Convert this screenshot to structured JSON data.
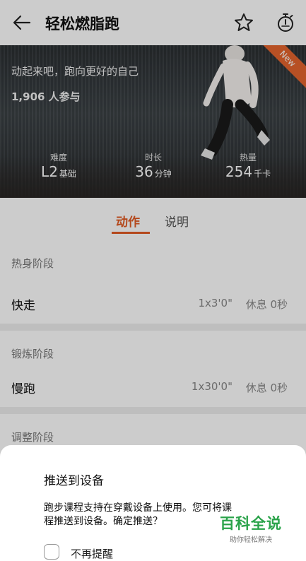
{
  "header": {
    "title": "轻松燃脂跑",
    "back_icon": "arrow-left-icon",
    "favorite_icon": "star-icon",
    "timer_icon": "stopwatch-icon"
  },
  "hero": {
    "tagline": "动起来吧，跑向更好的自己",
    "participants": "1,906 人参与",
    "badge": "New",
    "stats": [
      {
        "label": "难度",
        "value": "L2",
        "unit": "基础"
      },
      {
        "label": "时长",
        "value": "36",
        "unit": "分钟"
      },
      {
        "label": "热量",
        "value": "254",
        "unit": "千卡"
      }
    ]
  },
  "tabs": [
    {
      "label": "动作",
      "active": true
    },
    {
      "label": "说明",
      "active": false
    }
  ],
  "sections": [
    {
      "header": "热身阶段",
      "item": {
        "name": "快走",
        "reps": "1x3'0\"",
        "rest": "休息 0秒"
      }
    },
    {
      "header": "锻炼阶段",
      "item": {
        "name": "慢跑",
        "reps": "1x30'0\"",
        "rest": "休息 0秒"
      }
    },
    {
      "header": "调整阶段"
    }
  ],
  "dialog": {
    "title": "推送到设备",
    "message_line1": "跑步课程支持在穿戴设备上使用。您可将课",
    "message_line2": "程推送到设备。确定推送？",
    "checkbox_label": "不再提醒",
    "checked": false
  },
  "watermark": {
    "main": "百科全说",
    "sub": "助你轻松解决"
  },
  "colors": {
    "accent": "#e15a24",
    "watermark": "#2aa34a"
  }
}
